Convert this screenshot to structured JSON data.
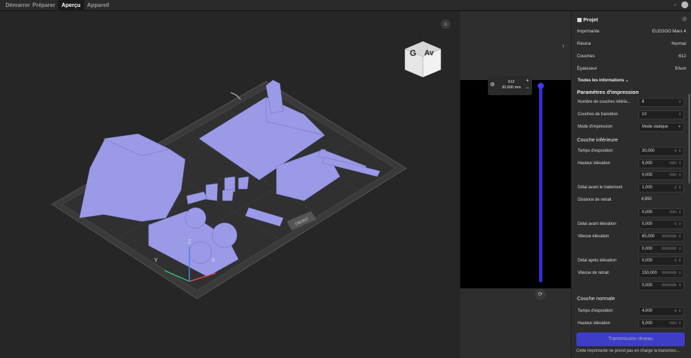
{
  "tabs": [
    "Démarrer",
    "Préparer",
    "Aperçu",
    "Appareil"
  ],
  "active_tab": "Aperçu",
  "viewcube": {
    "top": "H",
    "left": "G",
    "right": "Av"
  },
  "plate_label": "FRONT",
  "axes": {
    "x": "X",
    "y": "Y",
    "z": "Z"
  },
  "layer": {
    "number": "612",
    "height": "30,600 mm",
    "plus": "+",
    "minus": "−"
  },
  "panel": {
    "title": "Projet",
    "info": [
      {
        "label": "Imprimante",
        "value": "ELEGOO Mars 4"
      },
      {
        "label": "Résine",
        "value": "Normal"
      },
      {
        "label": "Couches",
        "value": "612"
      },
      {
        "label": "Épaisseur",
        "value": "50um"
      }
    ],
    "all_info": "Toutes les informations",
    "params_title": "Paramètres d'impression",
    "params": [
      {
        "label": "Nombre de couches inférie...",
        "value": "8"
      },
      {
        "label": "Couches de transition",
        "value": "10"
      },
      {
        "label": "Mode d'impression",
        "value": "Mode statique"
      }
    ],
    "bottom_title": "Couche inférieure",
    "bottom": [
      {
        "label": "Temps d'exposition",
        "value": "30,000",
        "unit": "s"
      },
      {
        "label": "Hauteur élévation",
        "value": "5,000",
        "unit": "mm"
      },
      {
        "label": "",
        "value": "0,000",
        "unit": "mm"
      },
      {
        "label": "Délai avant le traitement",
        "value": "1,000",
        "unit": "s"
      },
      {
        "label": "Distance de retrait",
        "value": "4,950",
        "unit": ""
      },
      {
        "label": "",
        "value": "0,000",
        "unit": "mm"
      },
      {
        "label": "Délai avant élévation",
        "value": "0,000",
        "unit": "s"
      },
      {
        "label": "Vitesse élévation",
        "value": "65,000",
        "unit": "mm/min"
      },
      {
        "label": "",
        "value": "0,000",
        "unit": "mm/min"
      },
      {
        "label": "Délai après élévation",
        "value": "0,000",
        "unit": "s"
      },
      {
        "label": "Vitesse de retrait",
        "value": "150,000",
        "unit": "mm/min"
      },
      {
        "label": "",
        "value": "0,000",
        "unit": "mm/min"
      }
    ],
    "normal_title": "Couche normale",
    "normal": [
      {
        "label": "Temps d'exposition",
        "value": "4,000",
        "unit": "s"
      },
      {
        "label": "Hauteur élévation",
        "value": "5,000",
        "unit": "mm"
      }
    ],
    "button": "Transmission réseau",
    "notice": "Cette imprimante ne prend pas en charge la transmiss..."
  },
  "colors": {
    "accent": "#3d3dc8",
    "model": "#9a9ae6",
    "slider": "#2f2fd6"
  }
}
